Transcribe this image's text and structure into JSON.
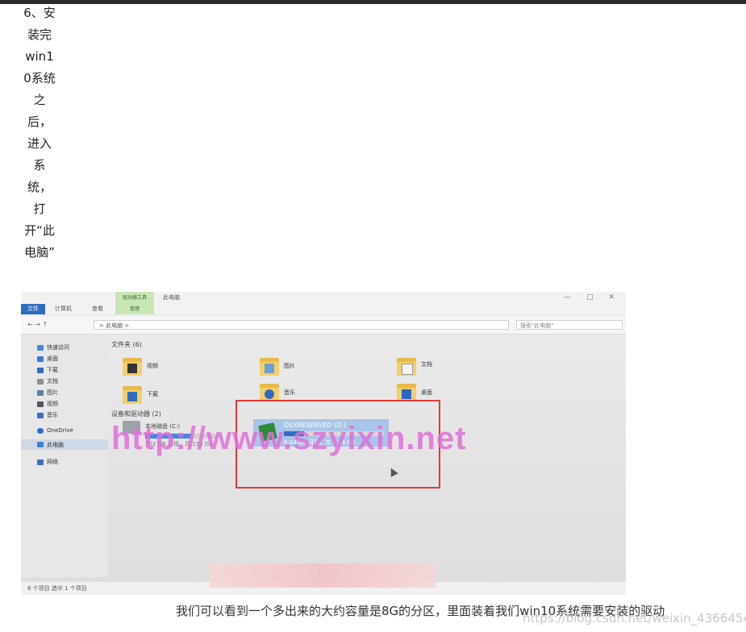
{
  "step": {
    "lines": [
      "6、安",
      "装完",
      "win1",
      "0系统",
      "之",
      "后，",
      "进入",
      "系",
      "统，",
      "打",
      "开“此",
      "电脑”"
    ]
  },
  "screenshot": {
    "ribbon": {
      "file_tab": "文件",
      "tab_computer": "计算机",
      "tab_view": "查看",
      "context_group": "驱动器工具",
      "context_manage": "管理",
      "window_title": "此电脑",
      "window_controls": "— □ ✕"
    },
    "address_bar": {
      "nav": "← → ↑",
      "path": "> 此电脑 >",
      "search_placeholder": "搜索\"此电脑\""
    },
    "sidebar": {
      "items": [
        "快速访问",
        "桌面",
        "下载",
        "文档",
        "图片",
        "视频",
        "音乐",
        "OneDrive",
        "此电脑",
        "网络"
      ]
    },
    "folders_group": "文件夹 (6)",
    "folders": [
      "视频",
      "图片",
      "文档",
      "下载",
      "音乐",
      "桌面"
    ],
    "devices_group": "设备和驱动器 (2)",
    "drive_c": {
      "name": "本地磁盘 (C:)",
      "info": "102 GB 可用，共 194 GB",
      "used_fraction": 0.6
    },
    "drive_d": {
      "name": "OSXRESERVED (D:)",
      "info": "8.24 GB 可用，共 8.24 GB",
      "used_fraction": 0.2
    },
    "status_bar": "8 个项目    选中 1 个项目",
    "watermark": "http://www.szyixin.net"
  },
  "caption": "我们可以看到一个多出来的大约容量是8G的分区，里面装着我们win10系统需要安装的驱动",
  "site_watermark": "https://blog.csdn.net/weixin_43664541",
  "colors": {
    "red_highlight": "#e53935",
    "watermark": "#e070d8",
    "selection": "#a7c6e8"
  }
}
